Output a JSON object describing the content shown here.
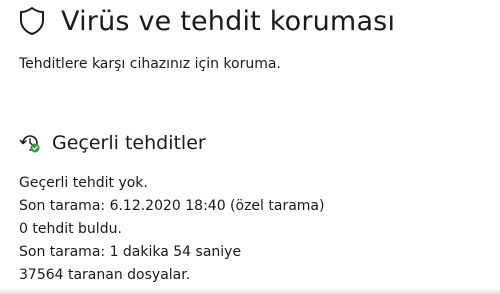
{
  "header": {
    "title": "Virüs ve tehdit koruması",
    "icon": "shield-icon"
  },
  "subtitle": "Tehditlere karşı cihazınız için koruma.",
  "current_threats": {
    "icon": "threat-scan-icon",
    "title": "Geçerli tehditler",
    "status": "Geçerli tehdit yok.",
    "last_scan": "Son tarama: 6.12.2020 18:40 (özel tarama)",
    "threats_found": "0 tehdit buldu.",
    "scan_duration": "Son tarama: 1 dakika 54 saniye",
    "files_scanned": "37564 taranan dosyalar."
  },
  "colors": {
    "text": "#1a1a1a",
    "accent_green": "#2e9e3a",
    "background": "#ffffff"
  }
}
